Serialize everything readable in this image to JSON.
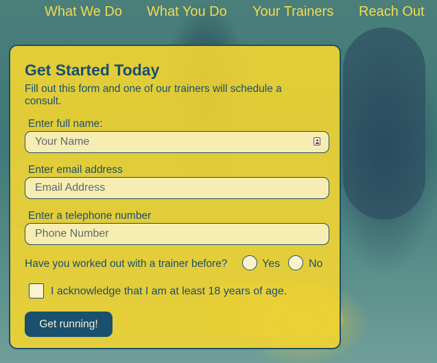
{
  "nav": {
    "items": [
      {
        "label": "What We Do"
      },
      {
        "label": "What You Do"
      },
      {
        "label": "Your Trainers"
      },
      {
        "label": "Reach Out"
      }
    ]
  },
  "form": {
    "title": "Get Started Today",
    "intro": "Fill out this form and one of our trainers will schedule a consult.",
    "name_label": "Enter full name:",
    "name_placeholder": "Your Name",
    "email_label": "Enter email address",
    "email_placeholder": "Email Address",
    "phone_label": "Enter a telephone number",
    "phone_placeholder": "Phone Number",
    "trainer_question": "Have you worked out with a trainer before?",
    "yes_label": "Yes",
    "no_label": "No",
    "age_ack_label": "I acknowledge that I am at least 18 years of age.",
    "submit_label": "Get running!"
  },
  "colors": {
    "accent": "#1a4f6e",
    "card": "#eed234",
    "nav_text": "#f3db52"
  },
  "icons": {
    "name_field_icon": "contact-card-icon"
  }
}
